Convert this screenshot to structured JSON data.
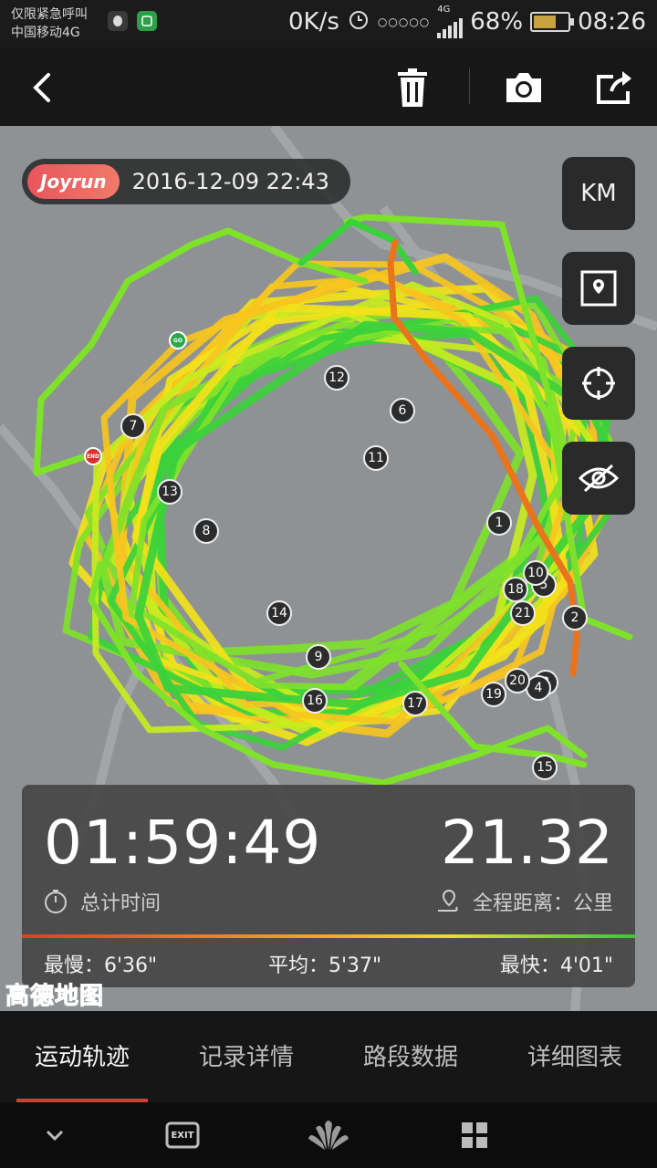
{
  "status_bar": {
    "carrier_line1": "仅限紧急呼叫",
    "carrier_line2": "中国移动4G",
    "net_speed": "0K/s",
    "network_type": "4G",
    "battery": "68%",
    "battery_level": 0.68,
    "time": "08:26",
    "icons": [
      "qq-icon",
      "wechat-icon",
      "alarm-icon",
      "dots-icon",
      "signal-icon",
      "battery-icon"
    ]
  },
  "toolbar": {
    "icons": [
      "back-icon",
      "trash-icon",
      "camera-icon",
      "share-icon"
    ]
  },
  "map": {
    "brand": "Joyrun",
    "datetime": "2016-12-09 22:43",
    "unit_button": "KM",
    "side_icons": [
      "map-layer-icon",
      "locate-icon",
      "hide-icon"
    ],
    "start_label": "GO",
    "end_label": "END",
    "markers": [
      "1",
      "2",
      "3",
      "4",
      "5",
      "6",
      "7",
      "8",
      "9",
      "10",
      "11",
      "12",
      "13",
      "14",
      "15",
      "16",
      "17",
      "18",
      "19",
      "20",
      "21"
    ],
    "provider_logo": "高德地图",
    "route_colors": [
      "#7ee22a",
      "#3bd13b",
      "#c8ec1e",
      "#f2e21a",
      "#f7c51f",
      "#e9741c"
    ]
  },
  "stats": {
    "total_time": "01:59:49",
    "total_time_label": "总计时间",
    "distance": "21.32",
    "distance_label": "全程距离：公里",
    "slowest_label": "最慢：",
    "slowest": "6'36\"",
    "average_label": "平均：",
    "average": "5'37\"",
    "fastest_label": "最快：",
    "fastest": "4'01\""
  },
  "tabs": [
    {
      "label": "运动轨迹",
      "active": true
    },
    {
      "label": "记录详情",
      "active": false
    },
    {
      "label": "路段数据",
      "active": false
    },
    {
      "label": "详细图表",
      "active": false
    }
  ],
  "nav_bar": {
    "exit_label": "EXIT",
    "icons": [
      "chevron-down-icon",
      "exit-icon",
      "huawei-logo-icon",
      "apps-icon"
    ]
  }
}
